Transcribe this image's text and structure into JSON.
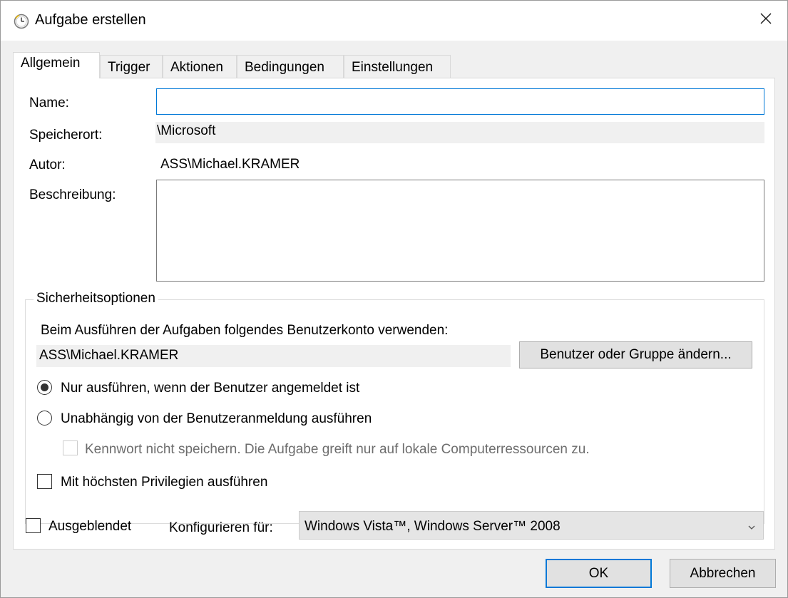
{
  "window": {
    "title": "Aufgabe erstellen"
  },
  "tabs": [
    {
      "label": "Allgemein"
    },
    {
      "label": "Trigger"
    },
    {
      "label": "Aktionen"
    },
    {
      "label": "Bedingungen"
    },
    {
      "label": "Einstellungen"
    }
  ],
  "general": {
    "name_label": "Name:",
    "name_value": "",
    "location_label": "Speicherort:",
    "location_value": "\\Microsoft",
    "author_label": "Autor:",
    "author_value": "ASS\\Michael.KRAMER",
    "description_label": "Beschreibung:",
    "description_value": ""
  },
  "security": {
    "group_title": "Sicherheitsoptionen",
    "account_prompt": "Beim Ausführen der Aufgaben folgendes Benutzerkonto verwenden:",
    "account_value": "ASS\\Michael.KRAMER",
    "change_user_button": "Benutzer oder Gruppe ändern...",
    "radio_logged_on": "Nur ausführen, wenn der Benutzer angemeldet ist",
    "radio_independent": "Unabhängig von der Benutzeranmeldung ausführen",
    "checkbox_no_password": "Kennwort nicht speichern. Die Aufgabe greift nur auf lokale Computerressourcen zu.",
    "checkbox_highest_privileges": "Mit höchsten Privilegien ausführen",
    "selected_radio": "logged_on"
  },
  "bottom": {
    "hidden_label": "Ausgeblendet",
    "configure_label": "Konfigurieren für:",
    "configure_value": "Windows Vista™, Windows Server™ 2008"
  },
  "buttons": {
    "ok": "OK",
    "cancel": "Abbrechen"
  },
  "colors": {
    "accent": "#0078d7",
    "window_bg": "#f0f0f0",
    "panel_bg": "#ffffff"
  },
  "icons": {
    "title": "task-scheduler-clock-icon",
    "close": "close-icon",
    "dropdown": "chevron-down-icon"
  }
}
